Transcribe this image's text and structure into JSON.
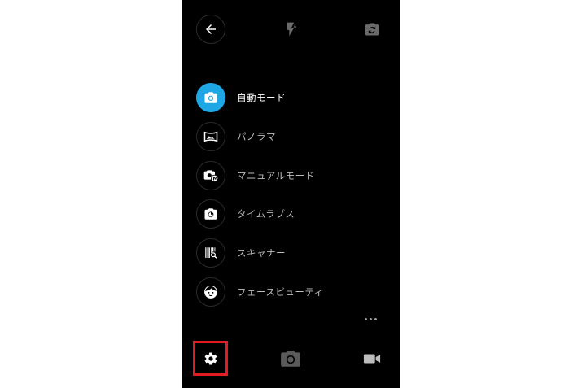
{
  "modes": [
    {
      "label": "自動モード",
      "icon": "camera-icon",
      "active": true
    },
    {
      "label": "パノラマ",
      "icon": "panorama-icon",
      "active": false
    },
    {
      "label": "マニュアルモード",
      "icon": "manual-camera-icon",
      "active": false
    },
    {
      "label": "タイムラプス",
      "icon": "timelapse-icon",
      "active": false
    },
    {
      "label": "スキャナー",
      "icon": "scanner-icon",
      "active": false
    },
    {
      "label": "フェースビューティ",
      "icon": "face-beauty-icon",
      "active": false
    }
  ],
  "colors": {
    "accent": "#1ea7e4",
    "highlight": "#e31c23",
    "background": "#000000"
  }
}
